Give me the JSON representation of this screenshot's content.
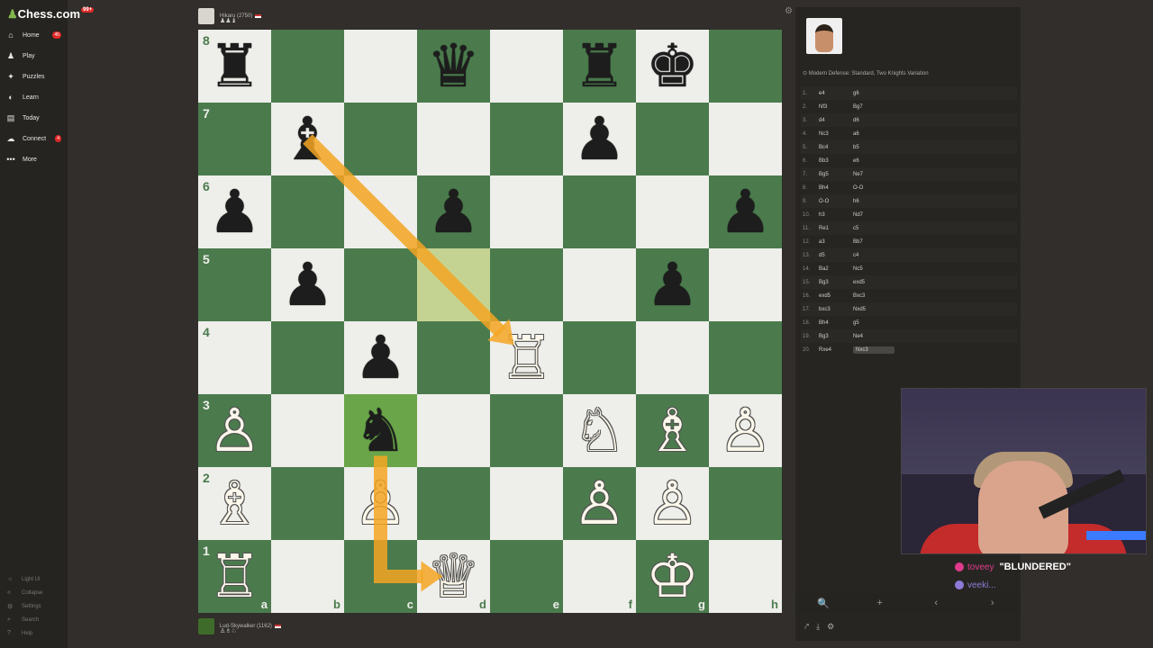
{
  "site": {
    "brand": "Chess.com",
    "badge": "99+"
  },
  "nav": [
    {
      "label": "Home",
      "icon": "home-icon",
      "glyph": "⌂",
      "count": "45"
    },
    {
      "label": "Play",
      "icon": "play-icon",
      "glyph": "♟",
      "count": ""
    },
    {
      "label": "Puzzles",
      "icon": "puzzle-icon",
      "glyph": "✦",
      "count": ""
    },
    {
      "label": "Learn",
      "icon": "learn-icon",
      "glyph": "◐",
      "count": ""
    },
    {
      "label": "Today",
      "icon": "today-icon",
      "glyph": "▤",
      "count": ""
    },
    {
      "label": "Connect",
      "icon": "connect-icon",
      "glyph": "☁",
      "count": "4"
    },
    {
      "label": "More",
      "icon": "more-icon",
      "glyph": "•••",
      "count": ""
    }
  ],
  "footer_nav": [
    {
      "label": "Light UI",
      "icon": "theme-icon",
      "glyph": "☼"
    },
    {
      "label": "Collapse",
      "icon": "collapse-icon",
      "glyph": "«"
    },
    {
      "label": "Settings",
      "icon": "settings-icon",
      "glyph": "⚙"
    },
    {
      "label": "Search",
      "icon": "search-icon",
      "glyph": "⌕"
    },
    {
      "label": "Help",
      "icon": "help-icon",
      "glyph": "?"
    }
  ],
  "top_player": {
    "name": "Hikaru (2750)",
    "captured": "♟♟♝"
  },
  "bottom_player": {
    "name": "Lud-Skywalker (1162)",
    "captured": "♙♗♘"
  },
  "board": {
    "ranks": [
      "8",
      "7",
      "6",
      "5",
      "4",
      "3",
      "2",
      "1"
    ],
    "files": [
      "a",
      "b",
      "c",
      "d",
      "e",
      "f",
      "g",
      "h"
    ],
    "colors": {
      "light": "#eeeeea",
      "dark": "#4b7b4d",
      "highlight": "#c5d392",
      "arrow": "#f5a623"
    },
    "highlights": [
      "d5",
      "c3"
    ],
    "pieces": {
      "a8": "♜b",
      "d8": "♛b",
      "f8": "♜b",
      "g8": "♚b",
      "b7": "♝b",
      "f7": "♟b",
      "a6": "♟b",
      "d6": "♟b",
      "h6": "♟b",
      "b5": "♟b",
      "g5": "♟b",
      "c4": "♟b",
      "e4": "♖w",
      "a3": "♙w",
      "c3": "♞b",
      "f3": "♘w",
      "g3": "♗w",
      "h3": "♙w",
      "a2": "♗w",
      "c2": "♙w",
      "f2": "♙w",
      "g2": "♙w",
      "a1": "♖w",
      "d1": "♕w",
      "g1": "♔w"
    },
    "arrows": [
      {
        "from": "b7",
        "to": "e4"
      },
      {
        "from": "c3",
        "to": "d1",
        "knight": true
      }
    ]
  },
  "panel": {
    "opening": "Modern Defense: Standard, Two Knights Variation",
    "moves": [
      {
        "n": "1.",
        "w": "e4",
        "b": "g6"
      },
      {
        "n": "2.",
        "w": "Nf3",
        "b": "Bg7"
      },
      {
        "n": "3.",
        "w": "d4",
        "b": "d6"
      },
      {
        "n": "4.",
        "w": "Nc3",
        "b": "a6"
      },
      {
        "n": "5.",
        "w": "Bc4",
        "b": "b5"
      },
      {
        "n": "6.",
        "w": "Bb3",
        "b": "e6"
      },
      {
        "n": "7.",
        "w": "Bg5",
        "b": "Ne7"
      },
      {
        "n": "8.",
        "w": "Bh4",
        "b": "O-O"
      },
      {
        "n": "9.",
        "w": "O-O",
        "b": "h6"
      },
      {
        "n": "10.",
        "w": "h3",
        "b": "Nd7"
      },
      {
        "n": "11.",
        "w": "Re1",
        "b": "c5"
      },
      {
        "n": "12.",
        "w": "a3",
        "b": "Bb7"
      },
      {
        "n": "13.",
        "w": "d5",
        "b": "c4"
      },
      {
        "n": "14.",
        "w": "Ba2",
        "b": "Nc5"
      },
      {
        "n": "15.",
        "w": "Bg3",
        "b": "exd5"
      },
      {
        "n": "16.",
        "w": "exd5",
        "b": "Bxc3"
      },
      {
        "n": "17.",
        "w": "bxc3",
        "b": "Nxd5"
      },
      {
        "n": "18.",
        "w": "Bh4",
        "b": "g5"
      },
      {
        "n": "19.",
        "w": "Bg3",
        "b": "Ne4"
      },
      {
        "n": "20.",
        "w": "Rxe4",
        "b": "Nxc3"
      }
    ],
    "toolbar": [
      "🔍",
      "+",
      "‹",
      "›"
    ]
  },
  "chat": [
    {
      "user": "toveey",
      "msg": "\"BLUNDERED\"",
      "color": "#e03a8c"
    },
    {
      "user": "veeki...",
      "msg": "",
      "color": "#8f7ad8"
    }
  ]
}
